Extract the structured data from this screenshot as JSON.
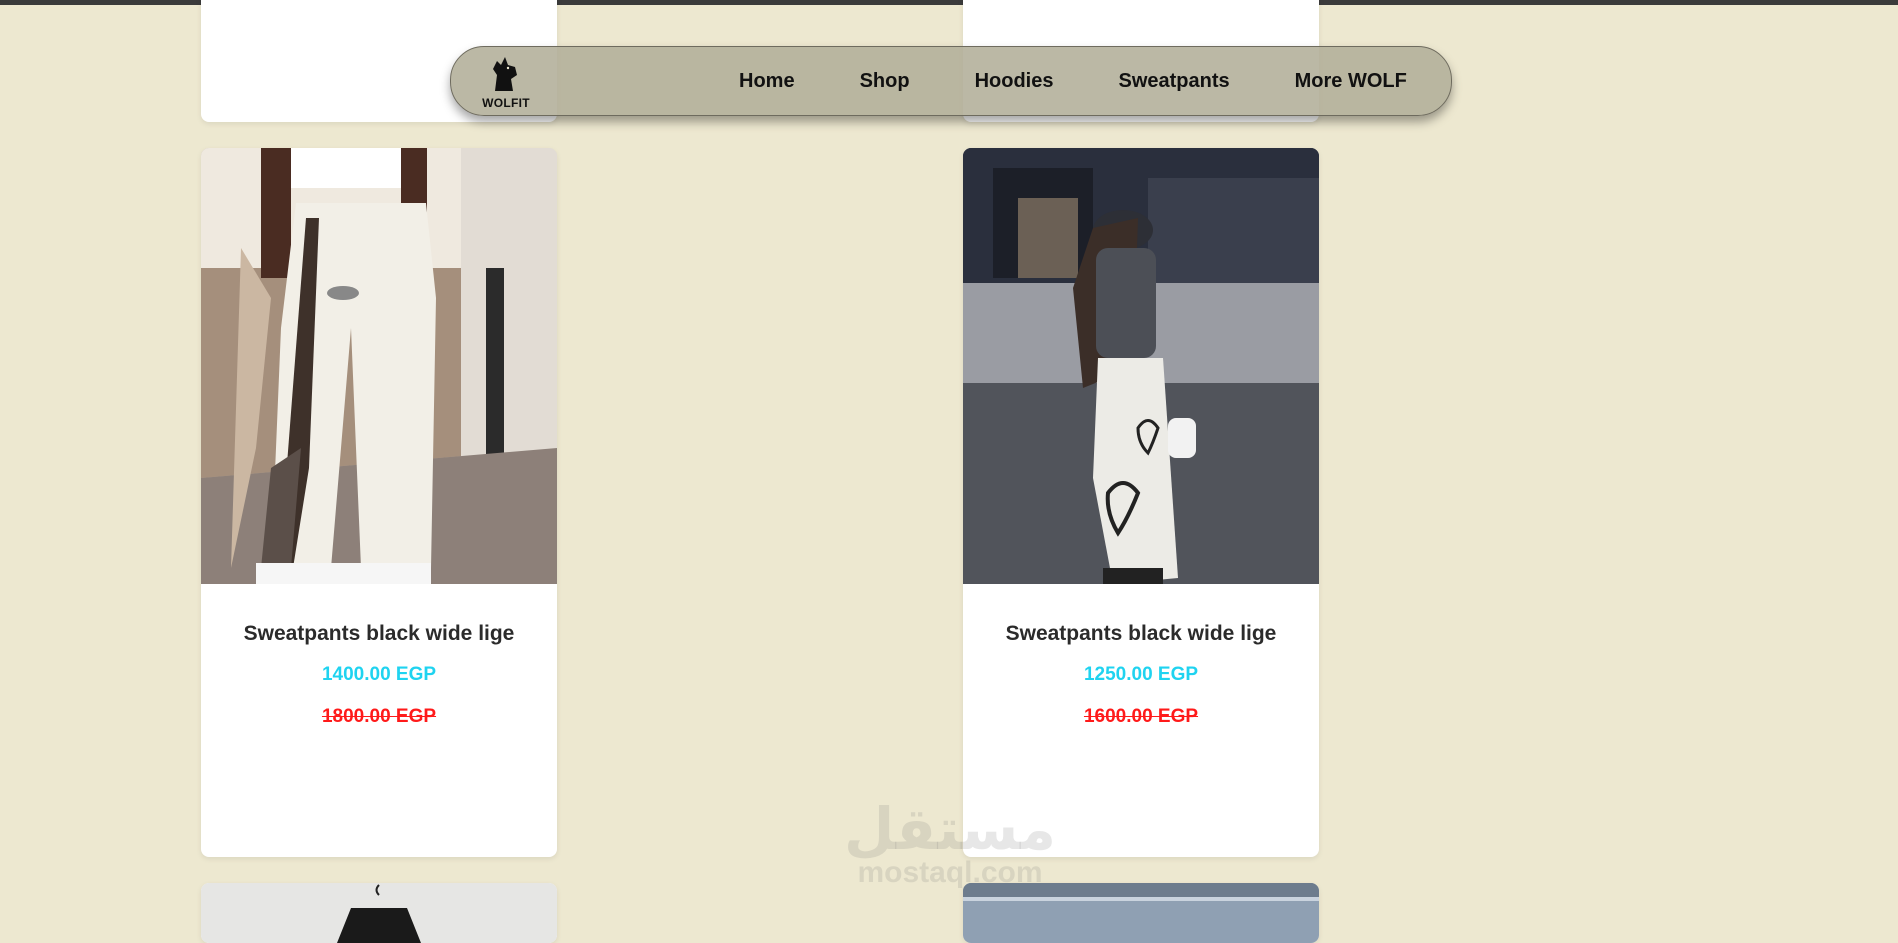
{
  "brand": {
    "logo_text": "WOLFIT"
  },
  "nav": {
    "items": [
      {
        "label": "Home"
      },
      {
        "label": "Shop"
      },
      {
        "label": "Hoodies"
      },
      {
        "label": "Sweatpants"
      },
      {
        "label": "More WOLF"
      }
    ]
  },
  "products": [
    {
      "title": "Sweatpants black wide lige",
      "price": "1400.00 EGP",
      "old_price": "1800.00 EGP"
    },
    {
      "title": "Sweatpants black wide lige",
      "price": "1250.00 EGP",
      "old_price": "1600.00 EGP"
    }
  ],
  "watermark": {
    "arabic": "مستقل",
    "latin": "mostaql.com"
  },
  "colors": {
    "background": "#ede8d0",
    "price": "#1fd3f0",
    "old_price": "#ff1a1a",
    "navbar": "#b2ae98"
  }
}
